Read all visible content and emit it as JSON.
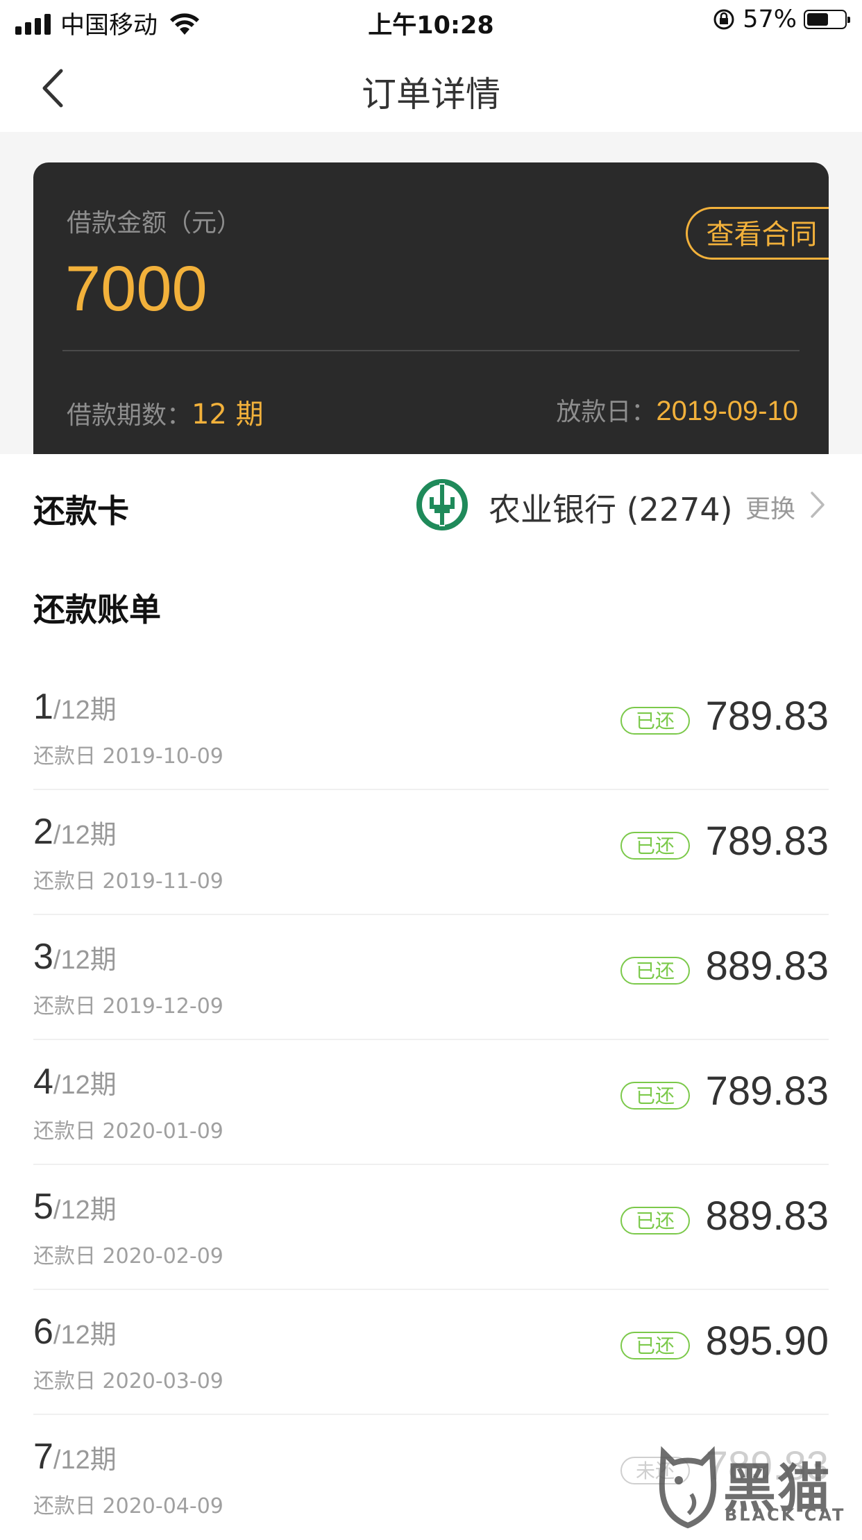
{
  "status_bar": {
    "carrier": "中国移动",
    "time": "上午10:28",
    "battery": "57%",
    "battery_level": 0.57
  },
  "nav": {
    "title": "订单详情"
  },
  "loan": {
    "amount_label": "借款金额（元）",
    "amount": "7000",
    "contract_button": "查看合同",
    "term_label": "借款期数：",
    "term_value": "12 期",
    "date_label": "放款日：",
    "date_value": "2019-09-10"
  },
  "repay_card": {
    "label": "还款卡",
    "bank": "农业银行 (2274)",
    "change": "更换"
  },
  "bills": {
    "title": "还款账单",
    "items": [
      {
        "num": "1",
        "total": "/12期",
        "due": "还款日 2019-10-09",
        "status": "已还",
        "amount": "789.83"
      },
      {
        "num": "2",
        "total": "/12期",
        "due": "还款日 2019-11-09",
        "status": "已还",
        "amount": "789.83"
      },
      {
        "num": "3",
        "total": "/12期",
        "due": "还款日 2019-12-09",
        "status": "已还",
        "amount": "889.83"
      },
      {
        "num": "4",
        "total": "/12期",
        "due": "还款日 2020-01-09",
        "status": "已还",
        "amount": "789.83"
      },
      {
        "num": "5",
        "total": "/12期",
        "due": "还款日 2020-02-09",
        "status": "已还",
        "amount": "889.83"
      },
      {
        "num": "6",
        "total": "/12期",
        "due": "还款日 2020-03-09",
        "status": "已还",
        "amount": "895.90"
      },
      {
        "num": "7",
        "total": "/12期",
        "due": "还款日 2020-04-09",
        "status": "未还",
        "amount": "789.83"
      }
    ]
  },
  "watermark": {
    "text": "黑猫",
    "sub": "BLACK CAT"
  },
  "colors": {
    "accent": "#f2b13b",
    "card_bg": "#2a2a2a",
    "paid_green": "#7bc94a",
    "bank_green": "#1f8a5a"
  }
}
